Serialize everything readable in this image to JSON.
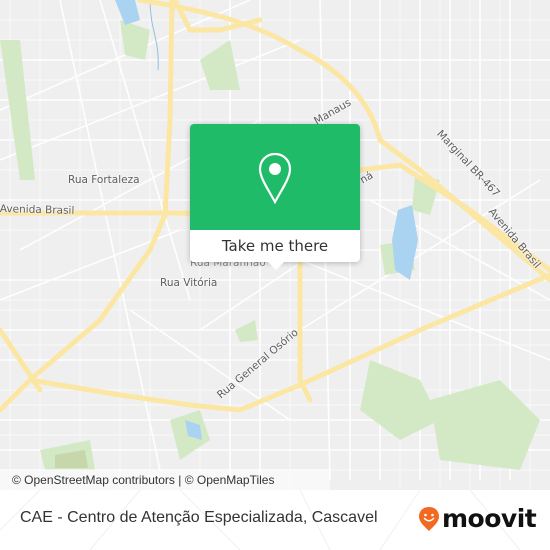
{
  "map": {
    "street_labels": [
      {
        "id": "rua-fortaleza",
        "text": "Rua Fortaleza"
      },
      {
        "id": "avenida-brasil-west",
        "text": "Avenida Brasil"
      },
      {
        "id": "rua-maranhao",
        "text": "Rua Maranhão"
      },
      {
        "id": "rua-vitoria",
        "text": "Rua Vitória"
      },
      {
        "id": "rua-general-osorio",
        "text": "Rua General Osório"
      },
      {
        "id": "marginal-br-467",
        "text": "Marginal BR-467"
      },
      {
        "id": "avenida-brasil-east",
        "text": "Avenida Brasil"
      },
      {
        "id": "rua-manaus-partial",
        "text": "Manaus"
      },
      {
        "id": "rua-partial-na",
        "text": "ná"
      }
    ],
    "colors": {
      "background": "#efefef",
      "minor_road": "#ffffff",
      "major_road": "#fbe9a6",
      "park": "#cfe8c0",
      "water": "#a9d3f2"
    },
    "attribution": "© OpenStreetMap contributors | © OpenMapTiles"
  },
  "popup": {
    "icon": "location-pin-icon",
    "button_label": "Take me there",
    "accent_color": "#1fbb68"
  },
  "footer": {
    "place_title": "CAE - Centro de Atenção Especializada, Cascavel",
    "brand": "moovit",
    "brand_color": "#f26a21"
  }
}
